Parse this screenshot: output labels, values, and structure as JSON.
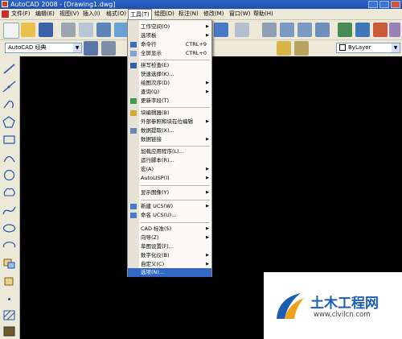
{
  "window": {
    "title": "AutoCAD 2008 - [Drawing1.dwg]"
  },
  "menubar": {
    "items": [
      "文件(F)",
      "编辑(E)",
      "视图(V)",
      "插入(I)",
      "格式(O)",
      "工具(T)",
      "绘图(D)",
      "标注(N)",
      "修改(M)",
      "窗口(W)",
      "帮助(H)"
    ],
    "active_index": 5
  },
  "toolbar": {
    "workspace_value": "AutoCAD 经典",
    "layer_value": "ByLayer"
  },
  "tools_menu": {
    "items": [
      {
        "label": "工作空间(O)",
        "submenu": true
      },
      {
        "label": "选项板",
        "submenu": true
      },
      {
        "label": "命令行",
        "shortcut": "CTRL+9"
      },
      {
        "label": "全屏显示",
        "shortcut": "CTRL+0"
      },
      {
        "label": "拼写检查(E)",
        "icon": "spell-check-icon"
      },
      {
        "label": "快速选择(K)..."
      },
      {
        "label": "绘图次序(D)",
        "submenu": true
      },
      {
        "label": "查询(Q)",
        "submenu": true
      },
      {
        "label": "更新字段(T)",
        "icon": "update-field-icon"
      },
      {
        "label": "块编辑器(B)",
        "icon": "block-editor-icon"
      },
      {
        "label": "外部参照和块在位编辑",
        "submenu": true
      },
      {
        "label": "数据提取(X)...",
        "icon": "data-extraction-icon"
      },
      {
        "label": "数据链接",
        "submenu": true
      },
      {
        "label": "加载应用程序(L)..."
      },
      {
        "label": "运行脚本(R)..."
      },
      {
        "label": "宏(A)",
        "submenu": true
      },
      {
        "label": "AutoLISP(I)",
        "submenu": true
      },
      {
        "label": "显示图像(Y)",
        "submenu": true
      },
      {
        "label": "新建 UCS(W)",
        "submenu": true,
        "icon": "new-ucs-icon"
      },
      {
        "label": "命名 UCS(U)...",
        "icon": "named-ucs-icon"
      },
      {
        "label": "CAD 标准(S)",
        "submenu": true
      },
      {
        "label": "向导(Z)",
        "submenu": true
      },
      {
        "label": "草图设置(F)..."
      },
      {
        "label": "数字化仪(B)",
        "submenu": true
      },
      {
        "label": "自定义(C)",
        "submenu": true
      },
      {
        "label": "选项(N)...",
        "selected": true
      }
    ]
  },
  "watermark": {
    "title": "土木工程网",
    "url": "www.civilcn.com"
  }
}
